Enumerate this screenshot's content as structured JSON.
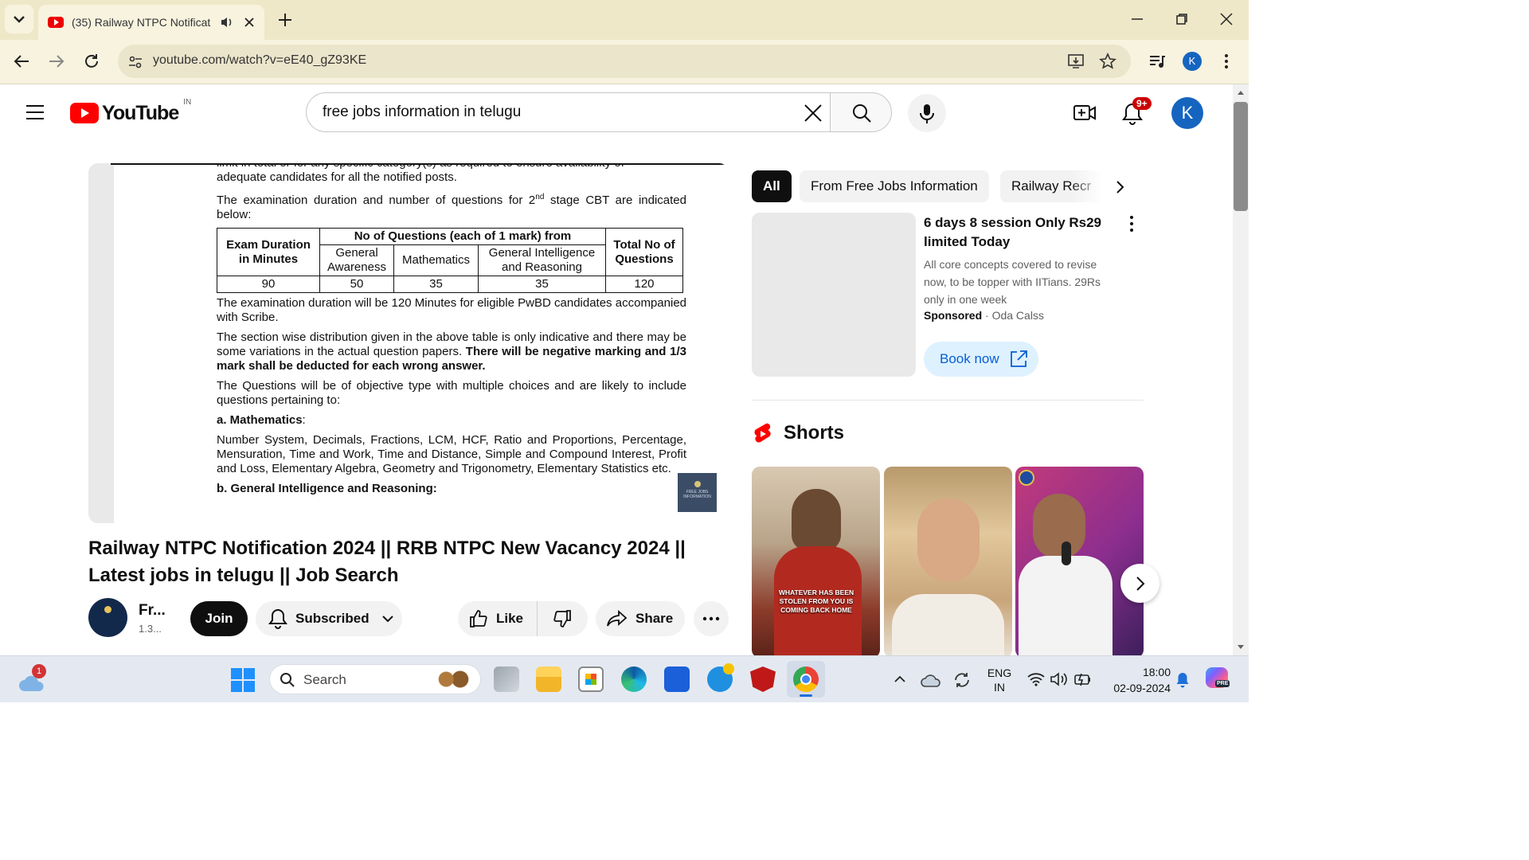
{
  "browser": {
    "tab_title": "(35) Railway NTPC Notificat",
    "url": "youtube.com/watch?v=eE40_gZ93KE",
    "profile_initial": "K"
  },
  "youtube": {
    "logo_text": "YouTube",
    "region": "IN",
    "search_value": "free jobs information in telugu",
    "notifications_badge": "9+",
    "account_initial": "K"
  },
  "video_frame": {
    "lines": {
      "top_cut": "limit in total or for any specific category(s) as required to ensure availability of",
      "p1": "adequate candidates for all the notified posts.",
      "p2_a": "The examination duration and number of questions for 2",
      "p2_sup": "nd",
      "p2_b": " stage CBT are indicated below:",
      "p3": "The examination duration will be 120 Minutes for eligible PwBD candidates accompanied with Scribe.",
      "p4_a": "The section wise distribution given in the above table is only indicative and there may be some variations in the actual question papers. ",
      "p4_b": "There will be negative marking and 1/3 mark shall be deducted for each wrong answer.",
      "p5": "The Questions will be of objective type with multiple choices and are likely to include questions pertaining to:",
      "h_math": "a. Mathematics",
      "h_math_colon": ":",
      "p6": "Number System, Decimals, Fractions, LCM, HCF, Ratio and Proportions, Percentage, Mensuration, Time and Work, Time and Distance, Simple and Compound Interest, Profit and Loss, Elementary Algebra, Geometry and Trigonometry, Elementary Statistics etc.",
      "h_gi": "b. General Intelligence and Reasoning:"
    },
    "table": {
      "col1": "Exam Duration in Minutes",
      "group": "No of Questions (each of 1 mark) from",
      "sub1": "General Awareness",
      "sub2": "Mathematics",
      "sub3": "General Intelligence and Reasoning",
      "col_total": "Total No of Questions",
      "row": [
        "90",
        "50",
        "35",
        "35",
        "120"
      ]
    },
    "watermark": "FREE JOBS INFORMATION"
  },
  "video": {
    "title": "Railway NTPC Notification 2024 || RRB NTPC New Vacancy 2024 || Latest jobs in telugu || Job Search",
    "channel_name": "Fr...",
    "subscribers": "1.3...",
    "join_label": "Join",
    "subscribed_label": "Subscribed",
    "like_label": "Like",
    "share_label": "Share"
  },
  "sidebar": {
    "chips": [
      "All",
      "From Free Jobs Information",
      "Railway Recr"
    ],
    "ad": {
      "title": "6 days 8 session Only Rs29 limited Today",
      "description": "All core concepts covered to revise now, to be topper with IITians. 29Rs only in one week",
      "sponsored": "Sponsored",
      "separator": " · ",
      "advertiser": "Oda Calss",
      "cta": "Book now"
    },
    "shorts_heading": "Shorts",
    "short1_caption": "WHATEVER HAS BEEN STOLEN FROM YOU IS COMING BACK HOME"
  },
  "taskbar": {
    "weather_badge": "1",
    "search_placeholder": "Search",
    "lang_top": "ENG",
    "lang_bottom": "IN",
    "time": "18:00",
    "date": "02-09-2024",
    "copilot_badge": "PRE"
  }
}
